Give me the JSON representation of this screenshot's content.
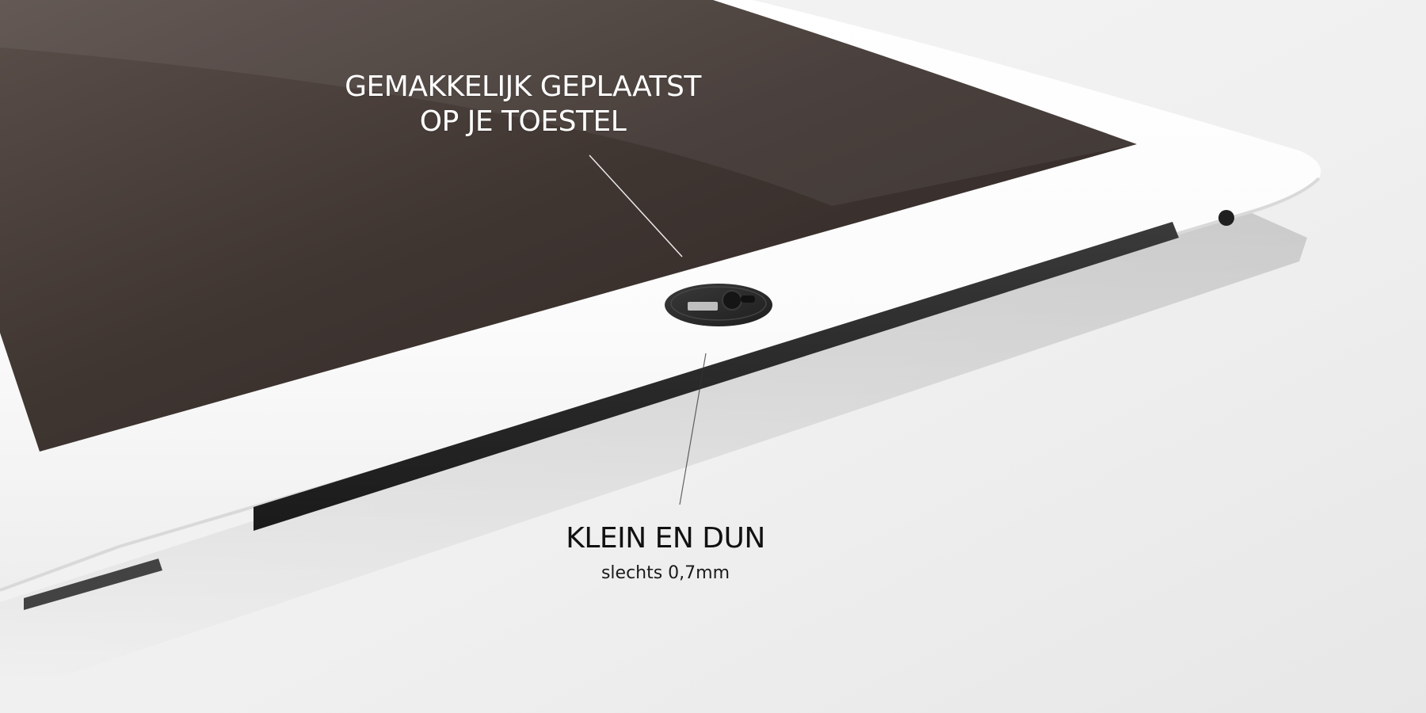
{
  "callouts": {
    "top": {
      "line1": "GEMAKKELIJK GEPLAATST",
      "line2": "OP JE TOESTEL"
    },
    "bottom": {
      "title": "KLEIN EN DUN",
      "subtitle": "slechts 0,7mm"
    }
  },
  "colors": {
    "background": "#f1f1f1",
    "screen": "#4a3f3a",
    "bezel": "#fbfbfb",
    "camera_cover": "#2a2a2a",
    "top_text": "#ffffff",
    "bottom_text": "#111111"
  },
  "objects": {
    "device": "tablet",
    "accessory": "webcam-cover"
  }
}
